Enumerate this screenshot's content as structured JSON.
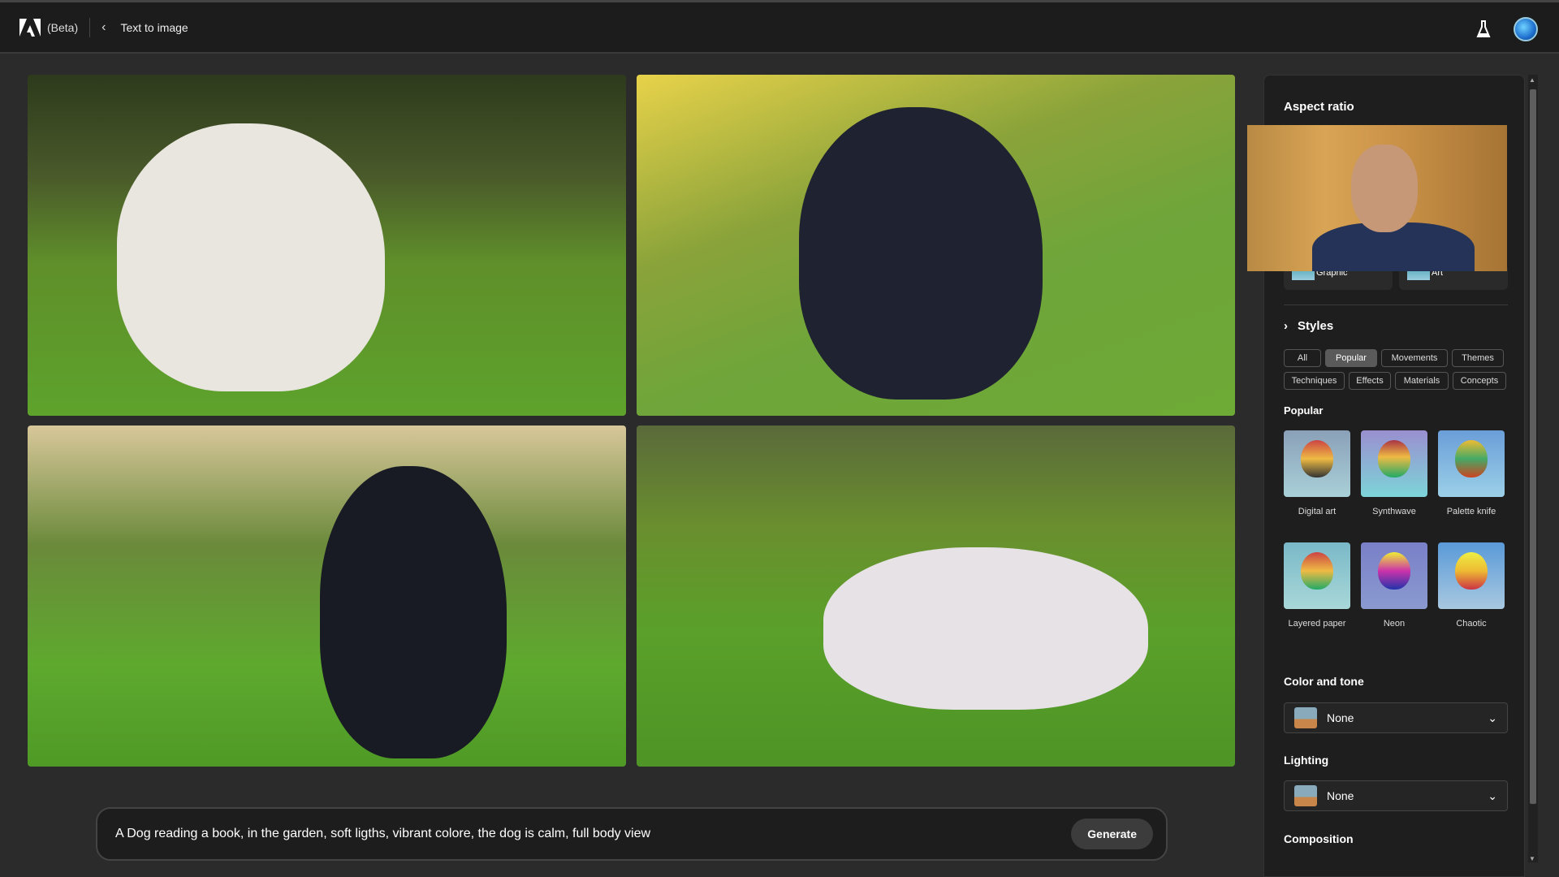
{
  "header": {
    "beta_label": "(Beta)",
    "title": "Text to image",
    "logo": "adobe-logo",
    "labs_icon": "flask-icon"
  },
  "gallery": {
    "images": [
      "white-dog-lying-on-grass",
      "black-dog-standing-in-garden",
      "black-dog-lying-on-grass",
      "spotted-dog-lying-on-grass"
    ]
  },
  "prompt": {
    "value": "A Dog reading a book, in the garden, soft ligths, vibrant colore, the dog is calm, full body view",
    "generate_label": "Generate"
  },
  "panel": {
    "aspect_ratio_title": "Aspect ratio",
    "content_type_options": [
      "Graphic",
      "Art"
    ],
    "styles_title": "Styles",
    "style_filters": [
      {
        "label": "All",
        "active": false
      },
      {
        "label": "Popular",
        "active": true
      },
      {
        "label": "Movements",
        "active": false
      },
      {
        "label": "Themes",
        "active": false
      },
      {
        "label": "Techniques",
        "active": false
      },
      {
        "label": "Effects",
        "active": false
      },
      {
        "label": "Materials",
        "active": false
      },
      {
        "label": "Concepts",
        "active": false
      }
    ],
    "popular_title": "Popular",
    "styles": [
      "Digital art",
      "Synthwave",
      "Palette knife",
      "Layered paper",
      "Neon",
      "Chaotic"
    ],
    "color_tone_title": "Color and tone",
    "color_tone_value": "None",
    "lighting_title": "Lighting",
    "lighting_value": "None",
    "composition_title": "Composition"
  }
}
